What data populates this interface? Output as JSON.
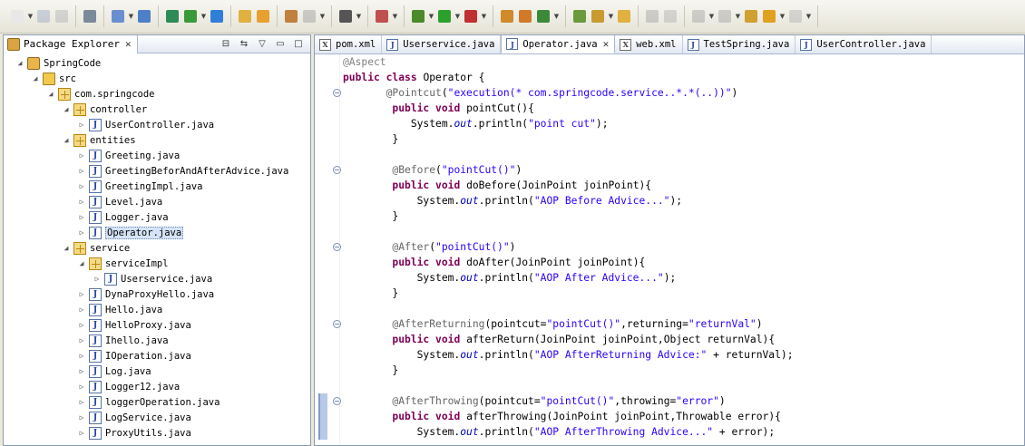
{
  "explorer": {
    "title": "Package Explorer",
    "tree": [
      {
        "label": "SpringCode",
        "depth": 0,
        "type": "project",
        "twisty": "open"
      },
      {
        "label": "src",
        "depth": 1,
        "type": "srcfolder",
        "twisty": "open"
      },
      {
        "label": "com.springcode",
        "depth": 2,
        "type": "package",
        "twisty": "open"
      },
      {
        "label": "controller",
        "depth": 3,
        "type": "package",
        "twisty": "open"
      },
      {
        "label": "UserController.java",
        "depth": 4,
        "type": "java",
        "twisty": "closed"
      },
      {
        "label": "entities",
        "depth": 3,
        "type": "package",
        "twisty": "open"
      },
      {
        "label": "Greeting.java",
        "depth": 4,
        "type": "java",
        "twisty": "closed"
      },
      {
        "label": "GreetingBeforAndAfterAdvice.java",
        "depth": 4,
        "type": "java",
        "twisty": "closed"
      },
      {
        "label": "GreetingImpl.java",
        "depth": 4,
        "type": "java",
        "twisty": "closed"
      },
      {
        "label": "Level.java",
        "depth": 4,
        "type": "java",
        "twisty": "closed"
      },
      {
        "label": "Logger.java",
        "depth": 4,
        "type": "java",
        "twisty": "closed"
      },
      {
        "label": "Operator.java",
        "depth": 4,
        "type": "java",
        "twisty": "closed",
        "selected": true
      },
      {
        "label": "service",
        "depth": 3,
        "type": "package",
        "twisty": "open"
      },
      {
        "label": "serviceImpl",
        "depth": 4,
        "type": "package",
        "twisty": "open"
      },
      {
        "label": "Userservice.java",
        "depth": 5,
        "type": "java",
        "twisty": "closed"
      },
      {
        "label": "DynaProxyHello.java",
        "depth": 4,
        "type": "java",
        "twisty": "closed"
      },
      {
        "label": "Hello.java",
        "depth": 4,
        "type": "java",
        "twisty": "closed"
      },
      {
        "label": "HelloProxy.java",
        "depth": 4,
        "type": "java",
        "twisty": "closed"
      },
      {
        "label": "Ihello.java",
        "depth": 4,
        "type": "java",
        "twisty": "closed"
      },
      {
        "label": "IOperation.java",
        "depth": 4,
        "type": "java",
        "twisty": "closed"
      },
      {
        "label": "Log.java",
        "depth": 4,
        "type": "java",
        "twisty": "closed"
      },
      {
        "label": "Logger12.java",
        "depth": 4,
        "type": "java",
        "twisty": "closed"
      },
      {
        "label": "loggerOperation.java",
        "depth": 4,
        "type": "java",
        "twisty": "closed"
      },
      {
        "label": "LogService.java",
        "depth": 4,
        "type": "java",
        "twisty": "closed"
      },
      {
        "label": "ProxyUtils.java",
        "depth": 4,
        "type": "java",
        "twisty": "closed"
      }
    ]
  },
  "editor": {
    "tabs": [
      {
        "label": "pom.xml",
        "kind": "xml",
        "active": false
      },
      {
        "label": "Userservice.java",
        "kind": "java",
        "active": false
      },
      {
        "label": "Operator.java",
        "kind": "java",
        "active": true
      },
      {
        "label": "web.xml",
        "kind": "xml",
        "active": false
      },
      {
        "label": "TestSpring.java",
        "kind": "java",
        "active": false
      },
      {
        "label": "UserController.java",
        "kind": "java",
        "active": false
      }
    ],
    "lines": [
      [
        {
          "t": "@Aspect",
          "c": "hl-faded"
        }
      ],
      [
        {
          "t": "public",
          "c": "kw"
        },
        {
          "t": " "
        },
        {
          "t": "class",
          "c": "kw"
        },
        {
          "t": " Operator {"
        }
      ],
      [
        {
          "t": "       "
        },
        {
          "t": "@Pointcut",
          "c": "ann"
        },
        {
          "t": "("
        },
        {
          "t": "\"execution(* com.springcode.service..*.*(..))\"",
          "c": "str"
        },
        {
          "t": ")"
        }
      ],
      [
        {
          "t": "        "
        },
        {
          "t": "public",
          "c": "kw"
        },
        {
          "t": " "
        },
        {
          "t": "void",
          "c": "kw"
        },
        {
          "t": " pointCut(){"
        }
      ],
      [
        {
          "t": "           System."
        },
        {
          "t": "out",
          "c": "fld"
        },
        {
          "t": ".println("
        },
        {
          "t": "\"point cut\"",
          "c": "str"
        },
        {
          "t": ");"
        }
      ],
      [
        {
          "t": "        }"
        }
      ],
      [
        {
          "t": ""
        }
      ],
      [
        {
          "t": "        "
        },
        {
          "t": "@Before",
          "c": "ann"
        },
        {
          "t": "("
        },
        {
          "t": "\"pointCut()\"",
          "c": "str"
        },
        {
          "t": ")"
        }
      ],
      [
        {
          "t": "        "
        },
        {
          "t": "public",
          "c": "kw"
        },
        {
          "t": " "
        },
        {
          "t": "void",
          "c": "kw"
        },
        {
          "t": " doBefore(JoinPoint joinPoint){"
        }
      ],
      [
        {
          "t": "            System."
        },
        {
          "t": "out",
          "c": "fld"
        },
        {
          "t": ".println("
        },
        {
          "t": "\"AOP Before Advice...\"",
          "c": "str"
        },
        {
          "t": ");"
        }
      ],
      [
        {
          "t": "        }"
        }
      ],
      [
        {
          "t": ""
        }
      ],
      [
        {
          "t": "        "
        },
        {
          "t": "@After",
          "c": "ann"
        },
        {
          "t": "("
        },
        {
          "t": "\"pointCut()\"",
          "c": "str"
        },
        {
          "t": ")"
        }
      ],
      [
        {
          "t": "        "
        },
        {
          "t": "public",
          "c": "kw"
        },
        {
          "t": " "
        },
        {
          "t": "void",
          "c": "kw"
        },
        {
          "t": " doAfter(JoinPoint joinPoint){"
        }
      ],
      [
        {
          "t": "            System."
        },
        {
          "t": "out",
          "c": "fld"
        },
        {
          "t": ".println("
        },
        {
          "t": "\"AOP After Advice...\"",
          "c": "str"
        },
        {
          "t": ");"
        }
      ],
      [
        {
          "t": "        }"
        }
      ],
      [
        {
          "t": ""
        }
      ],
      [
        {
          "t": "        "
        },
        {
          "t": "@AfterReturning",
          "c": "ann"
        },
        {
          "t": "(pointcut="
        },
        {
          "t": "\"pointCut()\"",
          "c": "str"
        },
        {
          "t": ",returning="
        },
        {
          "t": "\"returnVal\"",
          "c": "str"
        },
        {
          "t": ")"
        }
      ],
      [
        {
          "t": "        "
        },
        {
          "t": "public",
          "c": "kw"
        },
        {
          "t": " "
        },
        {
          "t": "void",
          "c": "kw"
        },
        {
          "t": " afterReturn(JoinPoint joinPoint,Object returnVal){"
        }
      ],
      [
        {
          "t": "            System."
        },
        {
          "t": "out",
          "c": "fld"
        },
        {
          "t": ".println("
        },
        {
          "t": "\"AOP AfterReturning Advice:\"",
          "c": "str"
        },
        {
          "t": " + returnVal);"
        }
      ],
      [
        {
          "t": "        }"
        }
      ],
      [
        {
          "t": ""
        }
      ],
      [
        {
          "t": "        "
        },
        {
          "t": "@AfterThrowing",
          "c": "ann"
        },
        {
          "t": "(pointcut="
        },
        {
          "t": "\"pointCut()\"",
          "c": "str"
        },
        {
          "t": ",throwing="
        },
        {
          "t": "\"error\"",
          "c": "str"
        },
        {
          "t": ")"
        }
      ],
      [
        {
          "t": "        "
        },
        {
          "t": "public",
          "c": "kw"
        },
        {
          "t": " "
        },
        {
          "t": "void",
          "c": "kw"
        },
        {
          "t": " afterThrowing(JoinPoint joinPoint,Throwable error){"
        }
      ],
      [
        {
          "t": "            System."
        },
        {
          "t": "out",
          "c": "fld"
        },
        {
          "t": ".println("
        },
        {
          "t": "\"AOP AfterThrowing Advice...\"",
          "c": "str"
        },
        {
          "t": " + error);"
        }
      ]
    ]
  },
  "toolbar": {
    "groups": [
      [
        {
          "icon": "new-icon",
          "color": "#E8E8E8",
          "arrow": true
        },
        {
          "icon": "save-icon",
          "color": "#9AA7C0",
          "disabled": true
        },
        {
          "icon": "print-icon",
          "color": "#B0B0B0",
          "disabled": true
        }
      ],
      [
        {
          "icon": "build-icon",
          "color": "#7A8A9A"
        }
      ],
      [
        {
          "icon": "open-type-icon",
          "color": "#6A8FD0",
          "arrow": true
        },
        {
          "icon": "search-icon",
          "color": "#4F7FC8"
        }
      ],
      [
        {
          "icon": "server-icon",
          "color": "#2E8B57"
        },
        {
          "icon": "run-server-icon",
          "color": "#3A9A3A",
          "arrow": true
        },
        {
          "icon": "web-browser-icon",
          "color": "#2F7FD8"
        }
      ],
      [
        {
          "icon": "new-folder-icon",
          "color": "#E0B040"
        },
        {
          "icon": "new-project-icon",
          "color": "#E8A030"
        }
      ],
      [
        {
          "icon": "properties-icon",
          "color": "#C08040"
        },
        {
          "icon": "globe-icon",
          "color": "#9A9A9A",
          "arrow": true,
          "disabled": true
        }
      ],
      [
        {
          "icon": "camera-icon",
          "color": "#555555",
          "arrow": true
        }
      ],
      [
        {
          "icon": "new-wizard-icon",
          "color": "#C05050",
          "arrow": true
        }
      ],
      [
        {
          "icon": "debug-icon",
          "color": "#4A8A2A",
          "arrow": true
        },
        {
          "icon": "run-icon",
          "color": "#2BA02B",
          "arrow": true
        },
        {
          "icon": "external-tools-icon",
          "color": "#C03030",
          "arrow": true
        }
      ],
      [
        {
          "icon": "new-java-class-icon",
          "color": "#D08A2A"
        },
        {
          "icon": "new-package-icon",
          "color": "#D07A2A"
        },
        {
          "icon": "refresh-icon",
          "color": "#3A8A3A",
          "arrow": true
        }
      ],
      [
        {
          "icon": "open-task-icon",
          "color": "#6A9A3A"
        },
        {
          "icon": "open-perspective-icon",
          "color": "#C89A30",
          "arrow": true
        },
        {
          "icon": "folder-open-icon",
          "color": "#E0B040"
        }
      ],
      [
        {
          "icon": "pin-icon",
          "color": "#A0A0A0",
          "disabled": true
        },
        {
          "icon": "pencil-icon",
          "color": "#B0B0B0",
          "disabled": true
        }
      ],
      [
        {
          "icon": "next-annotation-icon",
          "color": "#A0A0A0",
          "arrow": true,
          "disabled": true
        },
        {
          "icon": "prev-annotation-icon",
          "color": "#A0A0A0",
          "arrow": true,
          "disabled": true
        },
        {
          "icon": "last-edit-icon",
          "color": "#D0A030"
        },
        {
          "icon": "back-icon",
          "color": "#E0A020",
          "arrow": true
        },
        {
          "icon": "forward-icon",
          "color": "#B0B0B0",
          "arrow": true,
          "disabled": true
        }
      ]
    ]
  }
}
